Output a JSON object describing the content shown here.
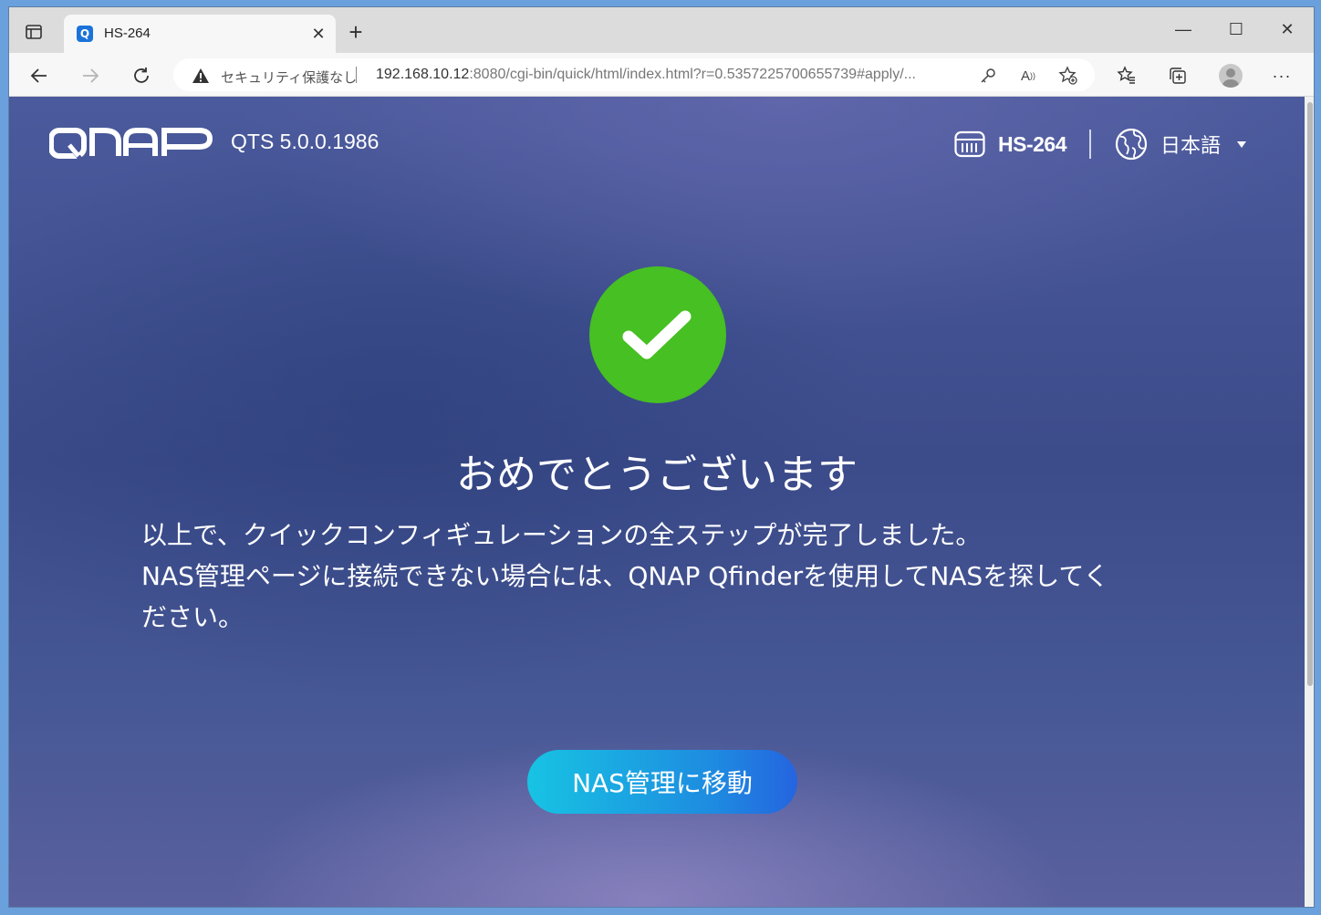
{
  "browser": {
    "tab": {
      "title": "HS-264",
      "favicon": "Q"
    },
    "new_tab_label": "+",
    "address": {
      "security_label": "セキュリティ保護なし",
      "url_host": "192.168.10.12",
      "url_rest": ":8080/cgi-bin/quick/html/index.html?r=0.5357225700655739#apply/..."
    },
    "icons": {
      "back": "back-arrow-icon",
      "forward": "forward-arrow-icon",
      "refresh": "refresh-icon",
      "warning": "warning-icon",
      "key": "key-icon",
      "read_aloud": "read-aloud-icon",
      "add_favorite": "add-favorite-icon",
      "favorites": "favorites-icon",
      "collections": "collections-icon",
      "profile": "profile-avatar",
      "menu": "more-menu-icon"
    }
  },
  "header": {
    "brand": "QNAP",
    "version": "QTS 5.0.0.1986",
    "device_name": "HS-264",
    "language": "日本語"
  },
  "main": {
    "title": "おめでとうございます",
    "message_lines": [
      "以上で、クイックコンフィギュレーションの全ステップが完了しました。",
      "NAS管理ページに接続できない場合には、QNAP Qfinderを使用してNASを探してく",
      "ださい。"
    ],
    "button_label": "NAS管理に移動"
  },
  "colors": {
    "success": "#46c022",
    "button_start": "#17c3e3",
    "button_end": "#2564e0",
    "background": "#3c4b8a"
  }
}
